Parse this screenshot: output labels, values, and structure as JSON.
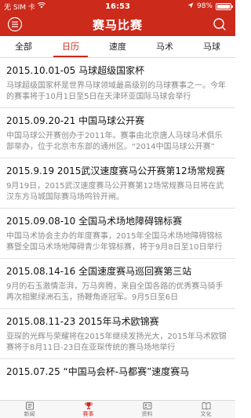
{
  "status_bar": {
    "carrier": "无 SIM 卡",
    "time": "16:53",
    "battery_text": "98%",
    "battery_level": 0.98
  },
  "nav": {
    "title": "赛马比赛"
  },
  "tabs": [
    {
      "label": "全部",
      "active": false
    },
    {
      "label": "日历",
      "active": true
    },
    {
      "label": "速度",
      "active": false
    },
    {
      "label": "马术",
      "active": false
    },
    {
      "label": "马球",
      "active": false
    }
  ],
  "events": [
    {
      "title": "2015.10.01-05  马球超级国家杯",
      "desc": "马球超级国家杯是世界马球领域最高级别的马球赛事之一。今年的赛事将于10月1日至5日在天津环亚国际马球会举行"
    },
    {
      "title": "2015.09.20-21  中国马球公开赛",
      "desc": "中国马球公开赛创办于2011年。赛事由北京唐人马球马术俱乐部举办，位于北京市东部的通州区。“2014中国马球公开赛”"
    },
    {
      "title": "2015.9.19  2015武汉速度赛马公开赛第12场常规赛",
      "desc": "9月19日，2015武汉速度赛马公开赛第12场常规赛马日将在武汉东方马城国际赛马场鸣铃开闸。"
    },
    {
      "title": "2015.09.08-10  全国马术场地障碍锦标赛",
      "desc": "中国马术协会主办的年度赛事，2015年全国马术场地障碍锦标赛暨全国马术场地障碍青少年锦标赛，将于9月8日至10日举行"
    },
    {
      "title": "2015.08.14-16  全国速度赛马巡回赛第三站",
      "desc": "9月的石玉激情澎湃，万马奔腾，来自全国各路的优秀赛马骑手再次相聚绿洲石玉，扬鞭角逐冠军。9月5日至6日"
    },
    {
      "title": "2015.08.11-23  2015年马术欧锦赛",
      "desc": "亚琛的光辉与荣耀将在2015年继续发扬光大，2015年马术欧锦赛将于8月11日-23日在亚琛传统的赛马场地举行"
    },
    {
      "title": "2015.07.25  “中国马会杯-马都赛”速度赛马",
      "desc": ""
    }
  ],
  "tabbar": [
    {
      "label": "新闻",
      "icon": "news-icon",
      "active": false
    },
    {
      "label": "赛事",
      "icon": "trophy-icon",
      "active": true
    },
    {
      "label": "资料",
      "icon": "profile-card-icon",
      "active": false
    },
    {
      "label": "文化",
      "icon": "book-icon",
      "active": false
    }
  ],
  "colors": {
    "brand": "#cc2a1b",
    "muted_text": "#8a8a8a",
    "divider": "#e2e2e2"
  }
}
